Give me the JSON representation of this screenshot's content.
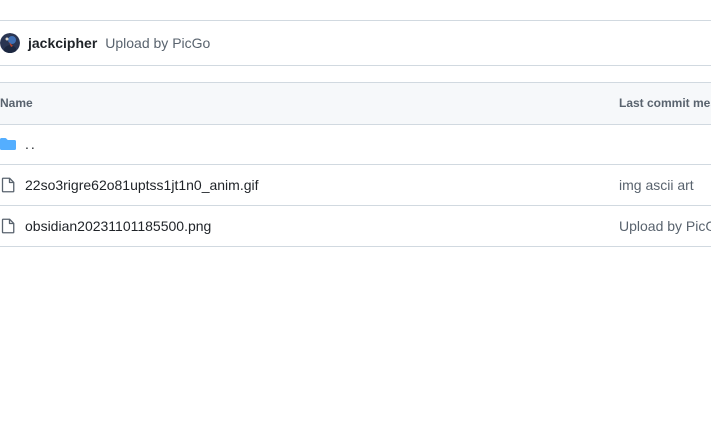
{
  "commit": {
    "author": "jackcipher",
    "message": "Upload by PicGo"
  },
  "table": {
    "columns": [
      "Name",
      "Last commit message"
    ],
    "parent_label": "..",
    "rows": [
      {
        "name": "22so3rigre62o81uptss1jt1n0_anim.gif",
        "commit_message": "img ascii art",
        "icon": "file-icon"
      },
      {
        "name": "obsidian20231101185500.png",
        "commit_message": "Upload by PicGo",
        "icon": "file-icon"
      }
    ]
  },
  "colors": {
    "border": "#d1d9e0",
    "header_bg": "#f6f8fa",
    "folder": "#54aeff",
    "muted_text": "#59636e"
  }
}
